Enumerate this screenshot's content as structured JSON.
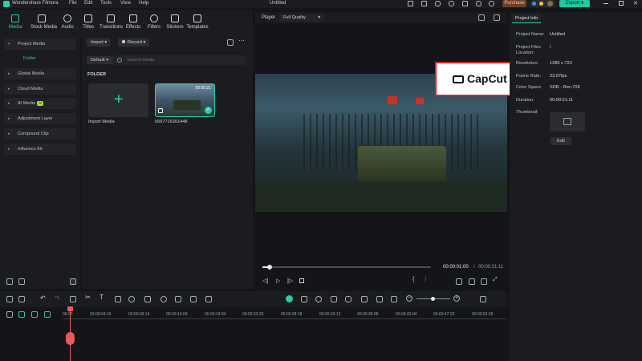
{
  "app": {
    "name": "Wondershare Filmora",
    "menu": [
      "File",
      "Edit",
      "Tools",
      "View",
      "Help"
    ],
    "document_title": "Untitled",
    "purchase_label": "Purchase",
    "export_label": "Export"
  },
  "toolbar": {
    "tabs": [
      {
        "label": "Media",
        "icon": "media-icon"
      },
      {
        "label": "Stock Media",
        "icon": "stock-media-icon"
      },
      {
        "label": "Audio",
        "icon": "audio-icon"
      },
      {
        "label": "Titles",
        "icon": "titles-icon"
      },
      {
        "label": "Transitions",
        "icon": "transitions-icon"
      },
      {
        "label": "Effects",
        "icon": "effects-icon"
      },
      {
        "label": "Filters",
        "icon": "filters-icon"
      },
      {
        "label": "Stickers",
        "icon": "stickers-icon"
      },
      {
        "label": "Templates",
        "icon": "templates-icon"
      }
    ],
    "active_tab": "Media"
  },
  "sidebar": {
    "items": [
      {
        "label": "Project Media"
      },
      {
        "label": "Global Media"
      },
      {
        "label": "Cloud Media"
      },
      {
        "label": "AI Media",
        "badge": "AI"
      },
      {
        "label": "Adjustment Layer"
      },
      {
        "label": "Compound Clip"
      },
      {
        "label": "Influence Kit"
      }
    ],
    "folder_label": "Folder"
  },
  "media_panel": {
    "import_label": "Import",
    "record_label": "Record",
    "sort_label": "Default",
    "search_placeholder": "Search media",
    "folder_heading": "FOLDER",
    "import_card_label": "Import Media",
    "clip": {
      "name": "6567716301448",
      "duration": "00:00:21"
    }
  },
  "player": {
    "label": "Player",
    "quality": "Full Quality",
    "current_time": "00:00:01:00",
    "separator": "/",
    "total_time": "00:00:21:11",
    "progress": 0.045,
    "watermark": "CapCut"
  },
  "project_info": {
    "tab_label": "Project Info",
    "rows": [
      {
        "label": "Project Name:",
        "value": "Untitled"
      },
      {
        "label": "Project Files Location:",
        "value": "/"
      },
      {
        "label": "Resolution:",
        "value": "1280 x 720"
      },
      {
        "label": "Frame Rate:",
        "value": "23.97fps"
      },
      {
        "label": "Color Space:",
        "value": "SDR - Rec.709"
      },
      {
        "label": "Duration:",
        "value": "00:00:21:11"
      }
    ],
    "thumbnail_label": "Thumbnail:",
    "edit_label": "Edit"
  },
  "timeline": {
    "ruler": [
      "00:00",
      "00:00:04:19",
      "00:00:09:14",
      "00:00:14:09",
      "00:00:19:04",
      "00:00:23:23",
      "00:00:28:18",
      "00:00:33:13",
      "00:00:38:08",
      "00:00:43:04",
      "00:00:47:23",
      "00:00:52:18"
    ]
  },
  "colors": {
    "accent": "#26d0ad",
    "purchase": "#6b3f2a",
    "export": "#1fc7a2",
    "highlight": "#e02020",
    "playhead": "#e85b5b"
  }
}
